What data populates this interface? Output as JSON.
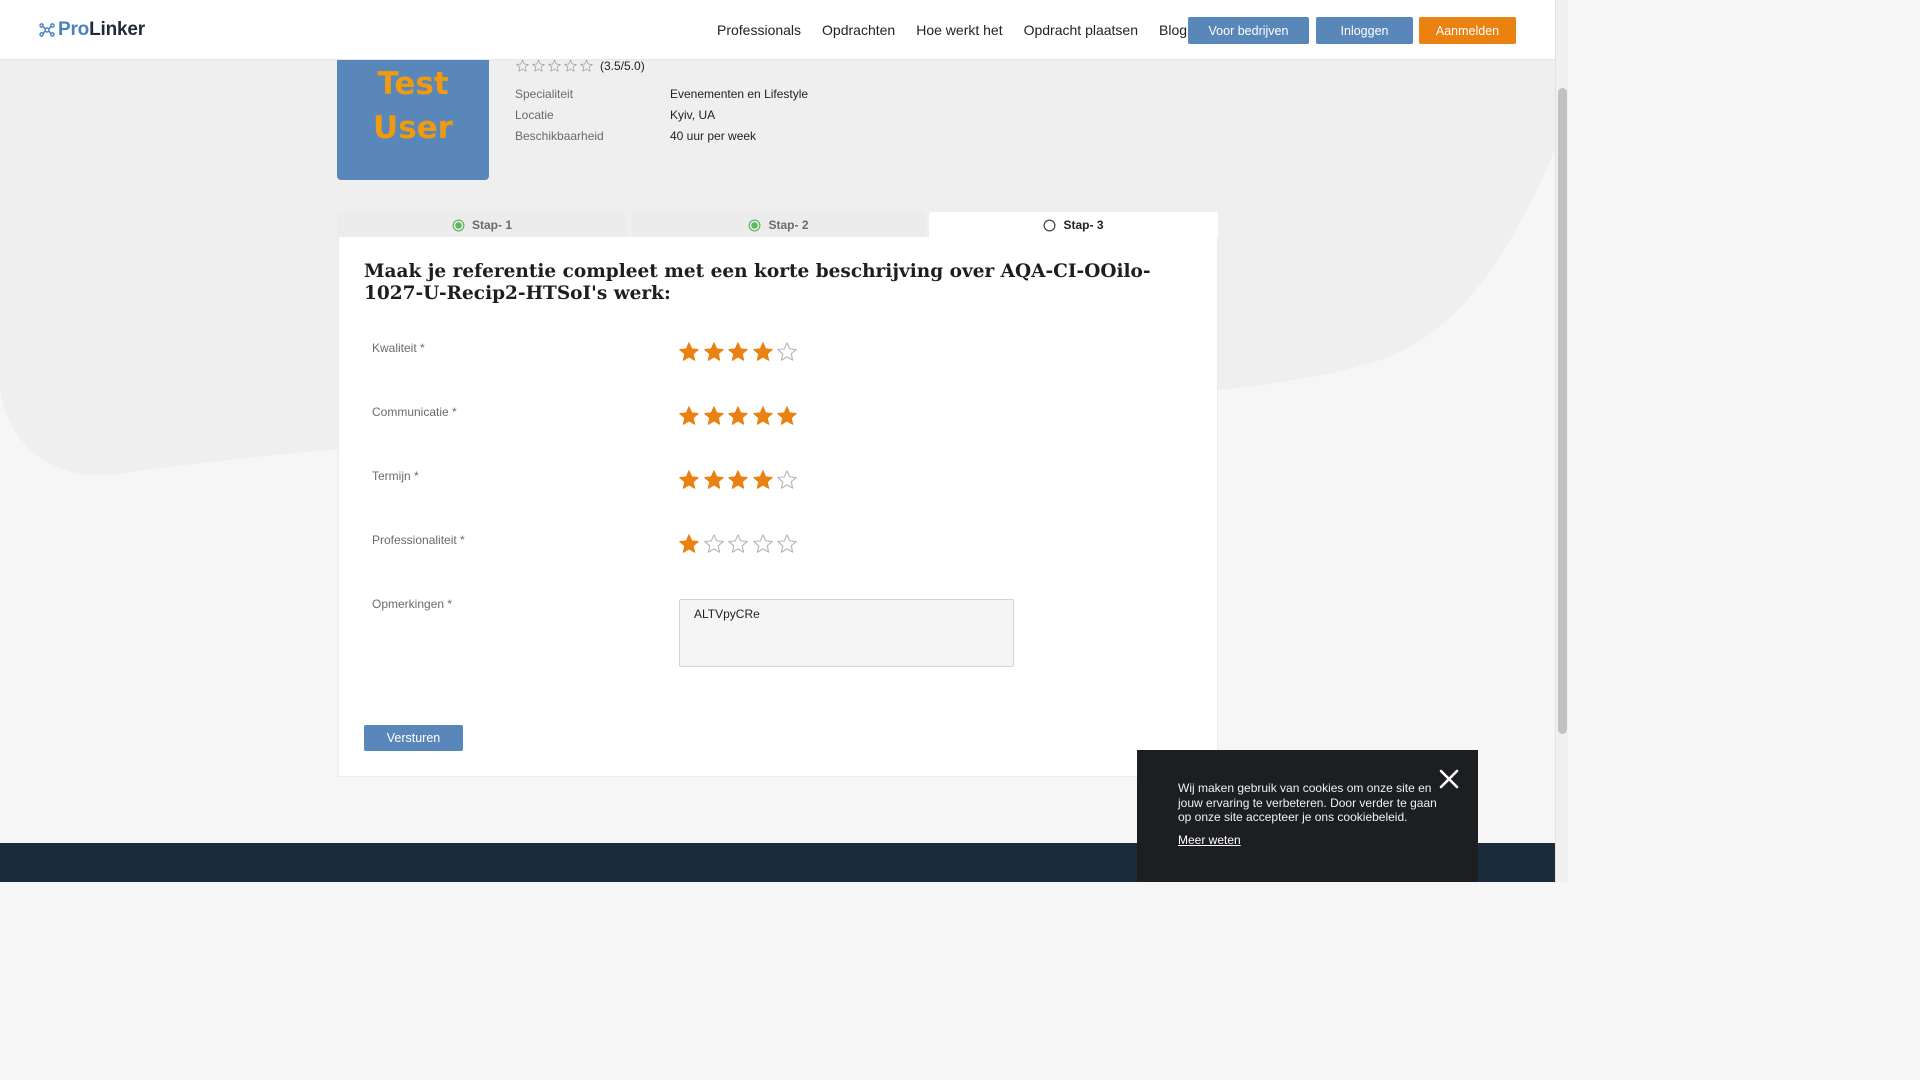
{
  "brand": {
    "name_part1": "Pro",
    "name_part2": "Linker"
  },
  "nav": [
    "Professionals",
    "Opdrachten",
    "Hoe werkt het",
    "Opdracht plaatsen",
    "Blog"
  ],
  "header_buttons": {
    "companies": "Voor bedrijven",
    "login": "Inloggen",
    "signup": "Aanmelden"
  },
  "profile": {
    "photo_text_line1": "Test",
    "photo_text_line2": "User",
    "rating_text": "(3.5/5.0)",
    "rating_value": 3.5,
    "details": [
      {
        "label": "Specialiteit",
        "value": "Evenementen en Lifestyle"
      },
      {
        "label": "Locatie",
        "value": "Kyiv, UA"
      },
      {
        "label": "Beschikbaarheid",
        "value": "40 uur per week"
      }
    ]
  },
  "steps": [
    {
      "label": "Stap- 1",
      "state": "done"
    },
    {
      "label": "Stap- 2",
      "state": "done"
    },
    {
      "label": "Stap- 3",
      "state": "active"
    }
  ],
  "form": {
    "title": "Maak je referentie compleet met een korte beschrijving over AQA-CI-OOilo-1027-U-Recip2-HTSoI's werk:",
    "ratings": [
      {
        "label": "Kwaliteit *",
        "value": 4
      },
      {
        "label": "Communicatie *",
        "value": 5
      },
      {
        "label": "Termijn *",
        "value": 4
      },
      {
        "label": "Professionaliteit *",
        "value": 1
      }
    ],
    "remarks_label": "Opmerkingen *",
    "remarks_value": "ALTVpyCRe",
    "submit_label": "Versturen"
  },
  "cookie": {
    "text": "Wij maken gebruik van cookies om onze site en jouw ervaring te verbeteren. Door verder te gaan op onze site accepteer je ons cookiebeleid.",
    "link": "Meer weten"
  },
  "colors": {
    "accent_blue": "#5a87b9",
    "accent_orange": "#e98210",
    "footer": "#1a2b3c",
    "cookie_bg": "#1c1e22"
  }
}
